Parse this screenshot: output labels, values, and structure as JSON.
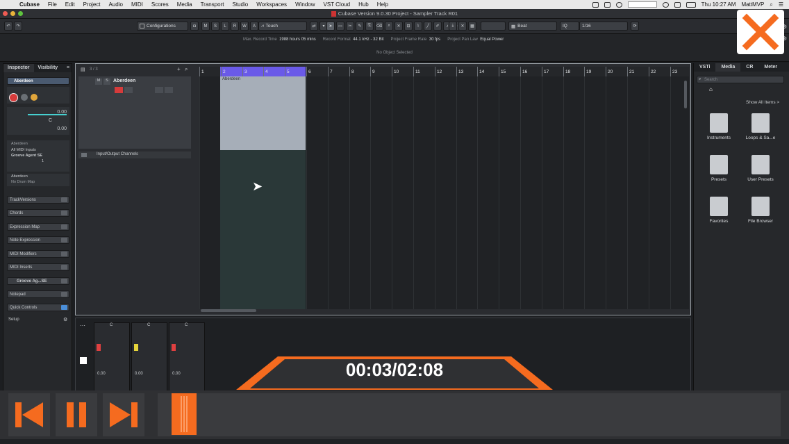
{
  "menubar": {
    "app": "Cubase",
    "items": [
      "File",
      "Edit",
      "Project",
      "Audio",
      "MIDI",
      "Scores",
      "Media",
      "Transport",
      "Studio",
      "Workspaces",
      "Window",
      "VST Cloud",
      "Hub",
      "Help"
    ],
    "clock": "Thu 10:27 AM",
    "user": "MattMVP"
  },
  "window": {
    "title": "Cubase Version 9.0.30 Project - Sampler Track R01"
  },
  "toolbar": {
    "configurations": "Configurations",
    "mode_buttons": [
      "M",
      "S",
      "L",
      "R",
      "W",
      "A"
    ],
    "automation_mode": "Touch",
    "grid_type": "Beat",
    "quantize": "1/16"
  },
  "infoline": {
    "max_record_time_label": "Max. Record Time",
    "max_record_time": "1988 hours 05 mins",
    "record_format_label": "Record Format",
    "record_format": "44.1 kHz - 32 Bit",
    "frame_rate_label": "Project Frame Rate",
    "frame_rate": "30 fps",
    "pan_law_label": "Project Pan Law",
    "pan_law": "Equal Power",
    "selection": "No Object Selected"
  },
  "inspector": {
    "tabs": [
      "Inspector",
      "Visibility"
    ],
    "track_name": "Aberdeen",
    "routing": {
      "input_label": "Aberdeen",
      "midi_input": "All MIDI Inputs",
      "output": "Groove Agent SE",
      "channel": "1",
      "program": "Aberdeen",
      "drum_map": "No Drum Map"
    },
    "readouts": [
      "0.00",
      "C",
      "0.00"
    ],
    "sections": [
      "TrackVersions",
      "Chords",
      "Expression Map",
      "Note Expression",
      "MIDI Modifiers",
      "MIDI Inserts",
      "Groove Ag...SE",
      "Notepad",
      "Quick Controls"
    ],
    "setup": "Setup"
  },
  "project": {
    "track_count": "3 / 3",
    "tracks": [
      {
        "name": "Aberdeen",
        "buttons": [
          "M",
          "S"
        ]
      },
      {
        "name": "Input/Output Channels"
      }
    ],
    "ruler": [
      "1",
      "2",
      "3",
      "4",
      "5",
      "6",
      "7",
      "8",
      "9",
      "10",
      "11",
      "12",
      "13",
      "14",
      "15",
      "16",
      "17",
      "18",
      "19",
      "20",
      "21",
      "22",
      "23"
    ],
    "part_name": "Aberdeen"
  },
  "rightzone": {
    "tabs": [
      "VSTi",
      "Media",
      "CR",
      "Meter"
    ],
    "search_placeholder": "Search",
    "show_all": "Show All Items >",
    "items": [
      "Instruments",
      "Loops & Sa...e",
      "Presets",
      "User Presets",
      "Favorites",
      "File Browser"
    ]
  },
  "mixer": {
    "strips": [
      {
        "pan": "C",
        "value": "0.00"
      },
      {
        "pan": "C",
        "value": "0.00"
      },
      {
        "pan": "C",
        "value": "0.00"
      }
    ]
  },
  "player": {
    "time": "00:03/02:08",
    "progress_fraction": 0.023,
    "accent": "#f56b1f"
  }
}
